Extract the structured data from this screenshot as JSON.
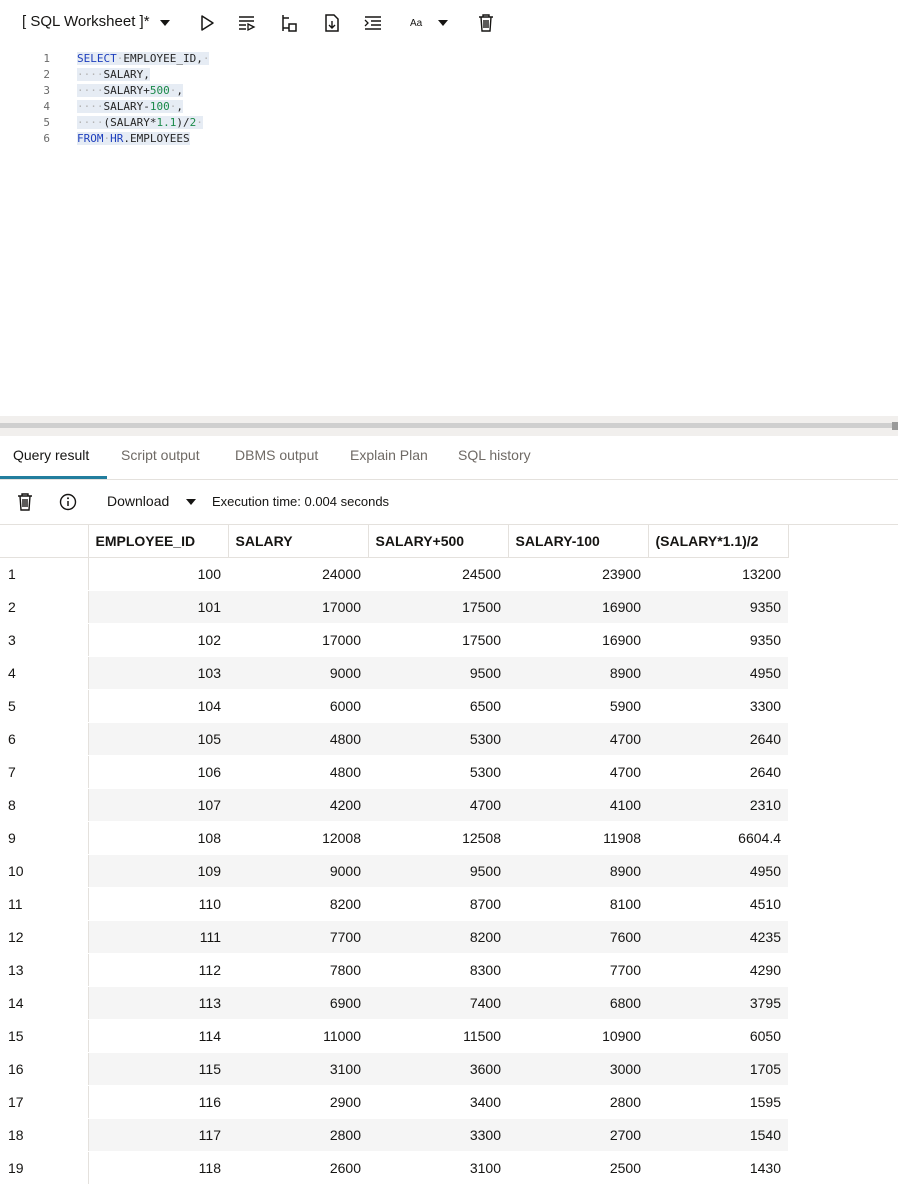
{
  "toolbar": {
    "worksheet_title": "[ SQL Worksheet ]*",
    "font_size_label": "Aa"
  },
  "editor": {
    "lines": [
      {
        "n": "1"
      },
      {
        "n": "2"
      },
      {
        "n": "3"
      },
      {
        "n": "4"
      },
      {
        "n": "5"
      },
      {
        "n": "6"
      }
    ],
    "tokens": {
      "select": "SELECT",
      "employee_id": "EMPLOYEE_ID,",
      "salary": "SALARY,",
      "salary_col": "SALARY",
      "plus": "+",
      "n500": "500",
      "comma": ",",
      "minus": "-",
      "n100": "100",
      "open_salary": "(SALARY",
      "mul": "*",
      "n1_1": "1.1",
      "close_div": ")/",
      "n2": "2",
      "from": "FROM",
      "hr": "HR",
      "employees": ".EMPLOYEES",
      "dot_space": "·",
      "indent": "····"
    }
  },
  "tabs": [
    "Query result",
    "Script output",
    "DBMS output",
    "Explain Plan",
    "SQL history"
  ],
  "results_toolbar": {
    "download_label": "Download",
    "execution_time": "Execution time: 0.004 seconds"
  },
  "grid": {
    "columns": [
      "EMPLOYEE_ID",
      "SALARY",
      "SALARY+500",
      "SALARY-100",
      "(SALARY*1.1)/2"
    ],
    "rows": [
      [
        "1",
        "100",
        "24000",
        "24500",
        "23900",
        "13200"
      ],
      [
        "2",
        "101",
        "17000",
        "17500",
        "16900",
        "9350"
      ],
      [
        "3",
        "102",
        "17000",
        "17500",
        "16900",
        "9350"
      ],
      [
        "4",
        "103",
        "9000",
        "9500",
        "8900",
        "4950"
      ],
      [
        "5",
        "104",
        "6000",
        "6500",
        "5900",
        "3300"
      ],
      [
        "6",
        "105",
        "4800",
        "5300",
        "4700",
        "2640"
      ],
      [
        "7",
        "106",
        "4800",
        "5300",
        "4700",
        "2640"
      ],
      [
        "8",
        "107",
        "4200",
        "4700",
        "4100",
        "2310"
      ],
      [
        "9",
        "108",
        "12008",
        "12508",
        "11908",
        "6604.4"
      ],
      [
        "10",
        "109",
        "9000",
        "9500",
        "8900",
        "4950"
      ],
      [
        "11",
        "110",
        "8200",
        "8700",
        "8100",
        "4510"
      ],
      [
        "12",
        "111",
        "7700",
        "8200",
        "7600",
        "4235"
      ],
      [
        "13",
        "112",
        "7800",
        "8300",
        "7700",
        "4290"
      ],
      [
        "14",
        "113",
        "6900",
        "7400",
        "6800",
        "3795"
      ],
      [
        "15",
        "114",
        "11000",
        "11500",
        "10900",
        "6050"
      ],
      [
        "16",
        "115",
        "3100",
        "3600",
        "3000",
        "1705"
      ],
      [
        "17",
        "116",
        "2900",
        "3400",
        "2800",
        "1595"
      ],
      [
        "18",
        "117",
        "2800",
        "3300",
        "2700",
        "1540"
      ],
      [
        "19",
        "118",
        "2600",
        "3100",
        "2500",
        "1430"
      ]
    ]
  },
  "colors": {
    "accent": "#227e9e",
    "keyword": "#1e3fbd",
    "number": "#1b8a4a"
  }
}
